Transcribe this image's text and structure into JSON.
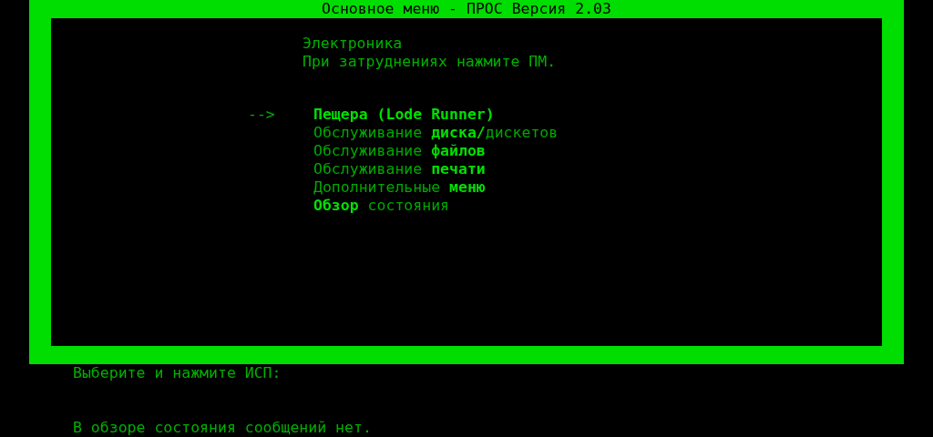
{
  "window": {
    "title": "Основное меню - ПРОС Версия 2.03"
  },
  "header": [
    "Электроника",
    "При затруднениях нажмите ПМ."
  ],
  "menu": {
    "pointer": "-->",
    "items": [
      {
        "label": "Пещера (Lode Runner)",
        "selected": true
      },
      {
        "label": "Обслуживание **диска/**дискетов",
        "selected": false
      },
      {
        "label": "Обслуживание **файлов**",
        "selected": false
      },
      {
        "label": "Обслуживание **печати**",
        "selected": false
      },
      {
        "label": "Дополнительные **меню**",
        "selected": false
      },
      {
        "label": "**Обзор** состояния",
        "selected": false
      }
    ]
  },
  "prompt": "Выберите и нажмите ИСП:",
  "status_message": "В обзоре состояния сообщений нет."
}
